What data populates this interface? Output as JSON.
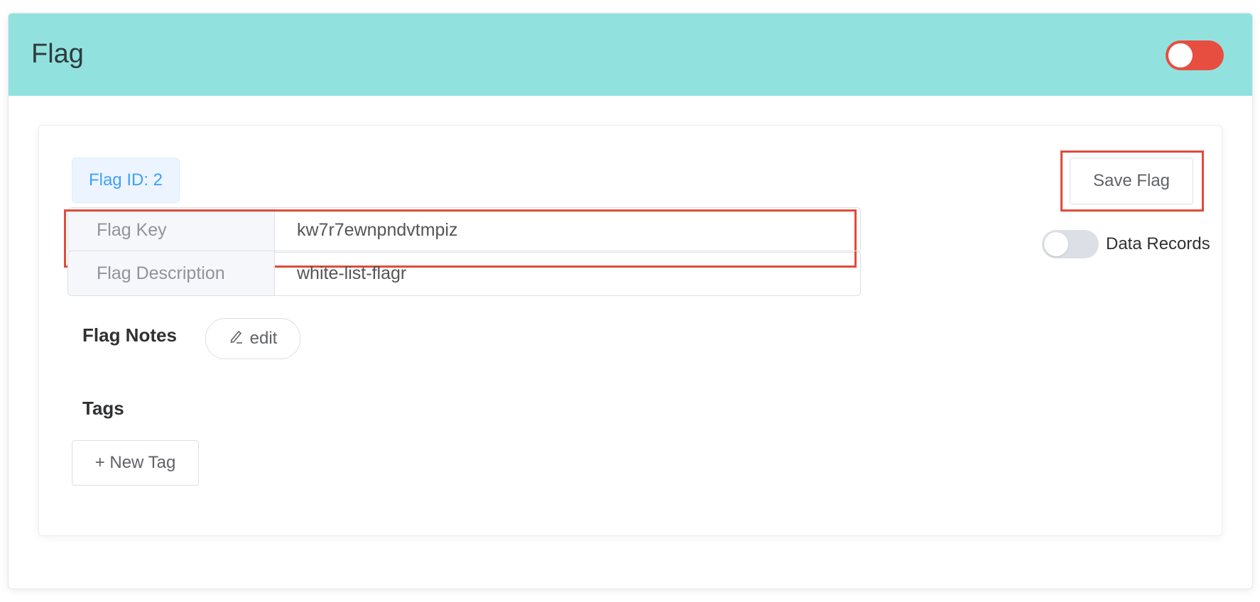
{
  "header": {
    "title": "Flag",
    "enabled_toggle": {
      "state": "off",
      "color": "#e84e40"
    }
  },
  "flag": {
    "id_badge": "Flag ID: 2",
    "key_label": "Flag Key",
    "key_value": "kw7r7ewnpndvtmpiz",
    "description_label": "Flag Description",
    "description_value": "white-list-flagr"
  },
  "actions": {
    "save_label": "Save Flag",
    "data_records_label": "Data Records",
    "data_records_toggle": "off"
  },
  "notes": {
    "title": "Flag Notes",
    "edit_label": "edit",
    "edit_icon": "edit-pencil-icon"
  },
  "tags": {
    "title": "Tags",
    "new_tag_label": "+ New Tag"
  },
  "colors": {
    "header_bg": "#91e2de",
    "highlight": "#e04b3a",
    "badge_text": "#409eff"
  }
}
